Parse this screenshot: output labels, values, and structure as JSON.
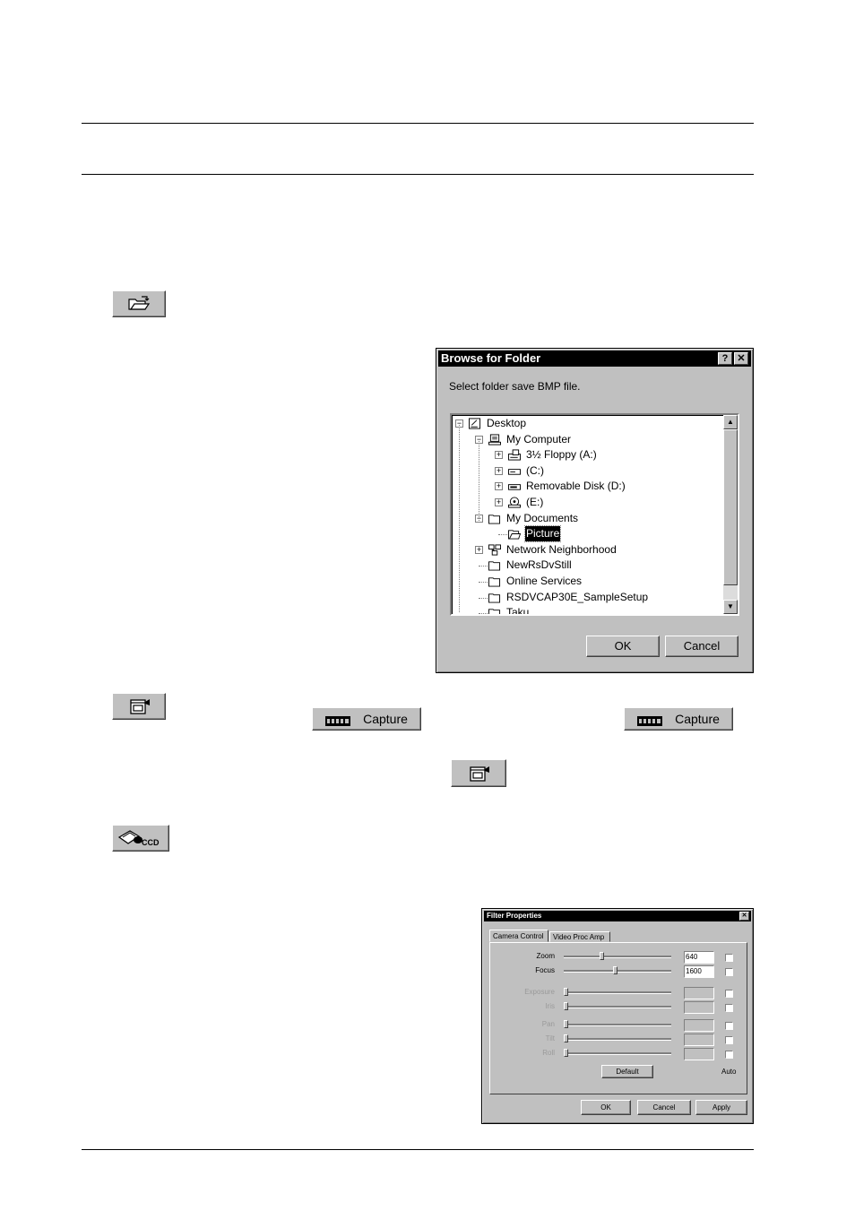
{
  "toolbar_icons": [
    {
      "name": "folder-open-icon"
    },
    {
      "name": "camera-capture-icon"
    },
    {
      "name": "ccd-camera-icon",
      "label": "CCD"
    }
  ],
  "capture_buttons": [
    {
      "label": "Capture",
      "icon": "film-strip-icon"
    },
    {
      "label": "Capture",
      "icon": "film-strip-icon"
    }
  ],
  "browse_dialog": {
    "title": "Browse for Folder",
    "help_btn": "?",
    "close_btn": "✕",
    "prompt": "Select folder save BMP file.",
    "tree": [
      {
        "label": "Desktop",
        "icon": "desktop-icon",
        "expander": "−"
      },
      {
        "label": "My Computer",
        "icon": "computer-icon",
        "expander": "−"
      },
      {
        "label": "3½ Floppy (A:)",
        "icon": "floppy-icon",
        "expander": "+"
      },
      {
        "label": "(C:)",
        "icon": "hard-disk-icon",
        "expander": "+"
      },
      {
        "label": "Removable Disk (D:)",
        "icon": "removable-disk-icon",
        "expander": "+"
      },
      {
        "label": "(E:)",
        "icon": "cd-drive-icon",
        "expander": "+"
      },
      {
        "label": "My Documents",
        "icon": "folder-icon",
        "expander": "−"
      },
      {
        "label": "Picture",
        "icon": "open-folder-icon",
        "expander": "",
        "selected": true
      },
      {
        "label": "Network Neighborhood",
        "icon": "network-icon",
        "expander": "+"
      },
      {
        "label": "NewRsDvStill",
        "icon": "folder-icon",
        "expander": ""
      },
      {
        "label": "Online Services",
        "icon": "folder-icon",
        "expander": ""
      },
      {
        "label": "RSDVCAP30E_SampleSetup",
        "icon": "folder-icon",
        "expander": ""
      },
      {
        "label": "Taku",
        "icon": "folder-icon",
        "expander": ""
      }
    ],
    "ok": "OK",
    "cancel": "Cancel"
  },
  "filter_dialog": {
    "title": "Filter Properties",
    "close_btn": "✕",
    "tabs": [
      "Camera Control",
      "Video Proc Amp"
    ],
    "controls": [
      {
        "label": "Zoom",
        "value": "640",
        "enabled": true,
        "level": 0.33
      },
      {
        "label": "Focus",
        "value": "1600",
        "enabled": true,
        "level": 0.46
      },
      {
        "label": "Exposure",
        "value": "",
        "enabled": false,
        "level": 0.0
      },
      {
        "label": "Iris",
        "value": "",
        "enabled": false,
        "level": 0.0
      },
      {
        "label": "Pan",
        "value": "",
        "enabled": false,
        "level": 0.0
      },
      {
        "label": "Tilt",
        "value": "",
        "enabled": false,
        "level": 0.0
      },
      {
        "label": "Roll",
        "value": "",
        "enabled": false,
        "level": 0.0
      }
    ],
    "default_btn": "Default",
    "auto_label": "Auto",
    "ok": "OK",
    "cancel": "Cancel",
    "apply": "Apply"
  }
}
